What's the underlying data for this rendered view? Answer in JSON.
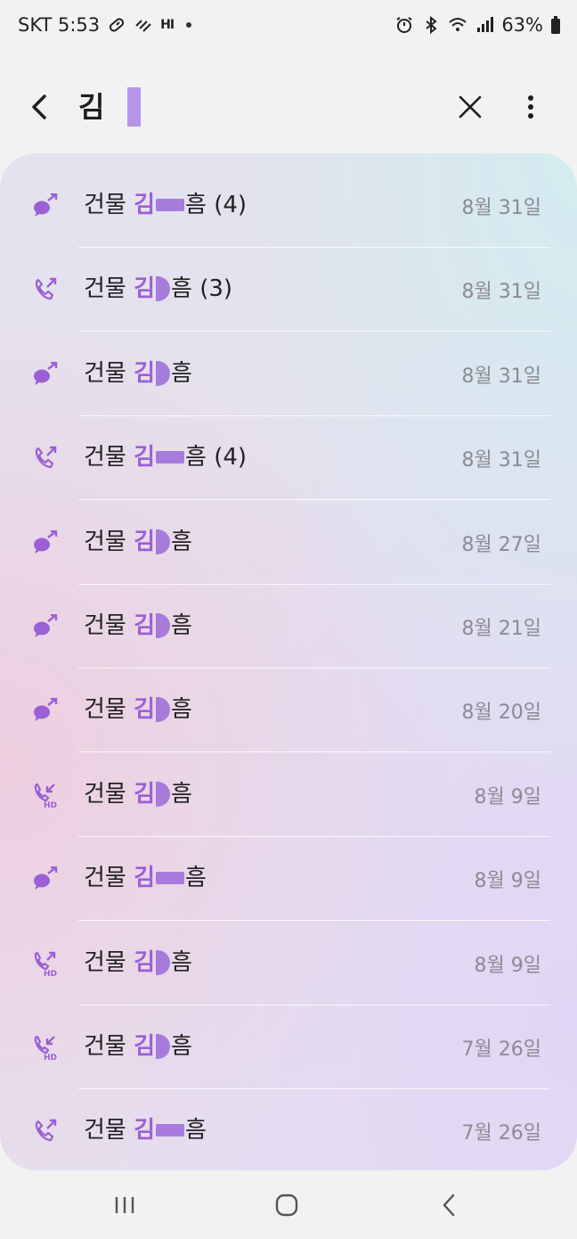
{
  "status_bar": {
    "carrier_time": "SKT 5:53",
    "hi": "HI",
    "battery": "63%",
    "icons": [
      "pill-icon",
      "signal-strength-lines-icon",
      "hi-network-icon",
      "alarm-icon",
      "bluetooth-icon",
      "wifi-icon",
      "cell-signal-icon",
      "battery-icon"
    ]
  },
  "search": {
    "query": "김",
    "icons": [
      "back-arrow-icon",
      "close-icon",
      "more-vert-icon"
    ]
  },
  "colors": {
    "accent": "#9b5fd6",
    "date": "#8c8a93",
    "background": "#f2f2f2"
  },
  "results": [
    {
      "icon": "message-icon",
      "prefix": "건물 ",
      "hl": "김",
      "suffix": "흠 (4)",
      "date": "8월 31일"
    },
    {
      "icon": "outgoing-call-icon",
      "prefix": "건물 ",
      "hl": "김",
      "suffix": "흠 (3)",
      "date": "8월 31일"
    },
    {
      "icon": "message-icon",
      "prefix": "건물 ",
      "hl": "김",
      "suffix": "흠",
      "date": "8월 31일"
    },
    {
      "icon": "outgoing-call-icon",
      "prefix": "건물 ",
      "hl": "김",
      "suffix": "흠 (4)",
      "date": "8월 31일"
    },
    {
      "icon": "message-icon",
      "prefix": "건물 ",
      "hl": "김",
      "suffix": "흠",
      "date": "8월 27일"
    },
    {
      "icon": "message-icon",
      "prefix": "건물 ",
      "hl": "김",
      "suffix": "흠",
      "date": "8월 21일"
    },
    {
      "icon": "message-icon",
      "prefix": "건물 ",
      "hl": "김",
      "suffix": "흠",
      "date": "8월 20일"
    },
    {
      "icon": "incoming-hd-call-icon",
      "prefix": "건물 ",
      "hl": "김",
      "suffix": "흠",
      "date": "8월 9일"
    },
    {
      "icon": "message-icon",
      "prefix": "건물 ",
      "hl": "김",
      "suffix": "흠",
      "date": "8월 9일"
    },
    {
      "icon": "outgoing-hd-call-icon",
      "prefix": "건물 ",
      "hl": "김",
      "suffix": "흠",
      "date": "8월 9일"
    },
    {
      "icon": "incoming-hd-call-icon",
      "prefix": "건물 ",
      "hl": "김",
      "suffix": "흠",
      "date": "7월 26일"
    },
    {
      "icon": "outgoing-call-icon",
      "prefix": "건물 ",
      "hl": "김",
      "suffix": "흠",
      "date": "7월 26일"
    }
  ],
  "nav": {
    "icons": [
      "recents-icon",
      "home-icon",
      "nav-back-icon"
    ]
  }
}
